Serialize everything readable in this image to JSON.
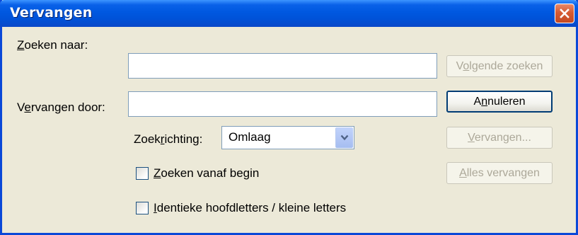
{
  "window": {
    "title": "Vervangen"
  },
  "find": {
    "label_pre": "",
    "label_key": "Z",
    "label_post": "oeken naar:",
    "value": ""
  },
  "replace": {
    "label_pre": "V",
    "label_key": "e",
    "label_post": "rvangen door:",
    "value": ""
  },
  "direction": {
    "label_pre": "Zoek",
    "label_key": "r",
    "label_post": "ichting:",
    "selected": "Omlaag"
  },
  "options": {
    "from_start": {
      "label_pre": "",
      "label_key": "Z",
      "label_post": "oeken vanaf begin",
      "checked": false
    },
    "match_case": {
      "label_pre": "",
      "label_key": "I",
      "label_post": "dentieke hoofdletters / kleine letters",
      "checked": false
    }
  },
  "buttons": {
    "find_next": {
      "pre": "V",
      "key": "o",
      "post": "lgende zoeken",
      "enabled": false
    },
    "cancel": {
      "pre": "A",
      "key": "n",
      "post": "nuleren",
      "enabled": true
    },
    "replace": {
      "pre": "",
      "key": "V",
      "post": "ervangen...",
      "enabled": false
    },
    "replace_all": {
      "pre": "",
      "key": "A",
      "post": "lles vervangen",
      "enabled": false
    }
  },
  "colors": {
    "titlebar": "#0058e0",
    "face": "#ece9d8",
    "close": "#d65a32"
  }
}
